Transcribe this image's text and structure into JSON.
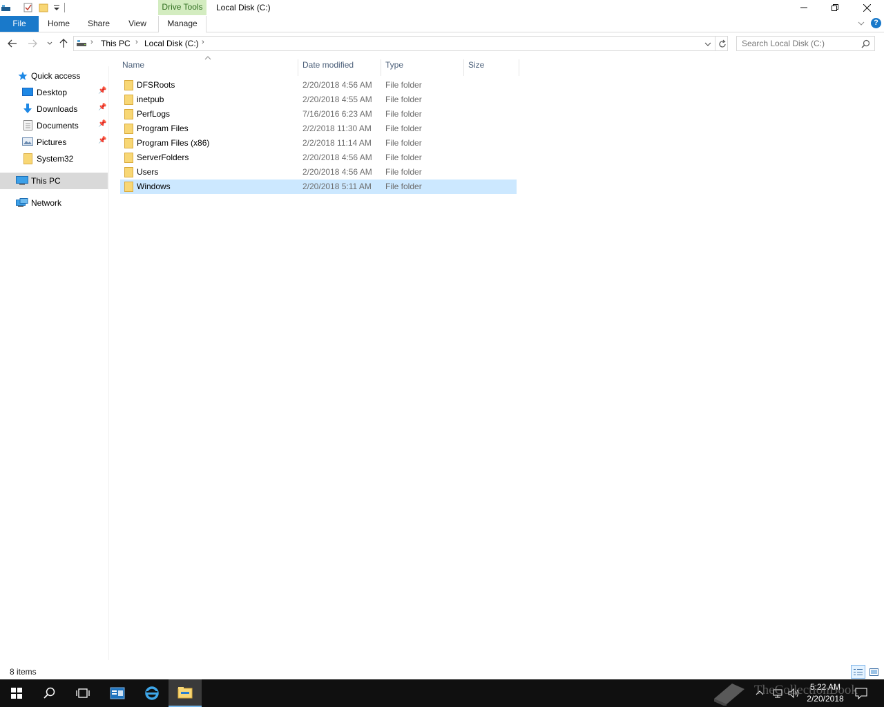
{
  "titlebar": {
    "title": "Local Disk (C:)",
    "context_tab": "Drive Tools",
    "buttons": [
      "minimize",
      "restore",
      "close"
    ]
  },
  "ribbon": {
    "tabs": [
      {
        "label": "File"
      },
      {
        "label": "Home"
      },
      {
        "label": "Share"
      },
      {
        "label": "View"
      },
      {
        "label": "Manage"
      }
    ]
  },
  "address": {
    "crumbs": [
      "This PC",
      "Local Disk (C:)"
    ],
    "search_placeholder": "Search Local Disk (C:)"
  },
  "navpane": {
    "quick_access": "Quick access",
    "items": [
      {
        "label": "Desktop",
        "icon": "desktop-icon",
        "pinned": true
      },
      {
        "label": "Downloads",
        "icon": "downloads-icon",
        "pinned": true
      },
      {
        "label": "Documents",
        "icon": "documents-icon",
        "pinned": true
      },
      {
        "label": "Pictures",
        "icon": "pictures-icon",
        "pinned": true
      },
      {
        "label": "System32",
        "icon": "folder-icon",
        "pinned": false
      }
    ],
    "this_pc": "This PC",
    "network": "Network"
  },
  "filelist": {
    "columns": [
      "Name",
      "Date modified",
      "Type",
      "Size"
    ],
    "sorted_by": "Name",
    "rows": [
      {
        "name": "DFSRoots",
        "date": "2/20/2018 4:56 AM",
        "type": "File folder",
        "selected": false
      },
      {
        "name": "inetpub",
        "date": "2/20/2018 4:55 AM",
        "type": "File folder",
        "selected": false
      },
      {
        "name": "PerfLogs",
        "date": "7/16/2016 6:23 AM",
        "type": "File folder",
        "selected": false
      },
      {
        "name": "Program Files",
        "date": "2/2/2018 11:30 AM",
        "type": "File folder",
        "selected": false
      },
      {
        "name": "Program Files (x86)",
        "date": "2/2/2018 11:14 AM",
        "type": "File folder",
        "selected": false
      },
      {
        "name": "ServerFolders",
        "date": "2/20/2018 4:56 AM",
        "type": "File folder",
        "selected": false
      },
      {
        "name": "Users",
        "date": "2/20/2018 4:56 AM",
        "type": "File folder",
        "selected": false
      },
      {
        "name": "Windows",
        "date": "2/20/2018 5:11 AM",
        "type": "File folder",
        "selected": true
      }
    ]
  },
  "status": {
    "count": "8 items"
  },
  "taskbar": {
    "time": "5:22 AM",
    "date": "2/20/2018",
    "watermark": "TheCollectionBook"
  },
  "colors": {
    "file_tab": "#1979ca",
    "drive_tools": "#d3ecc0",
    "selected_row": "#cce8ff",
    "taskbar": "#101010",
    "folder": "#f8d775"
  }
}
